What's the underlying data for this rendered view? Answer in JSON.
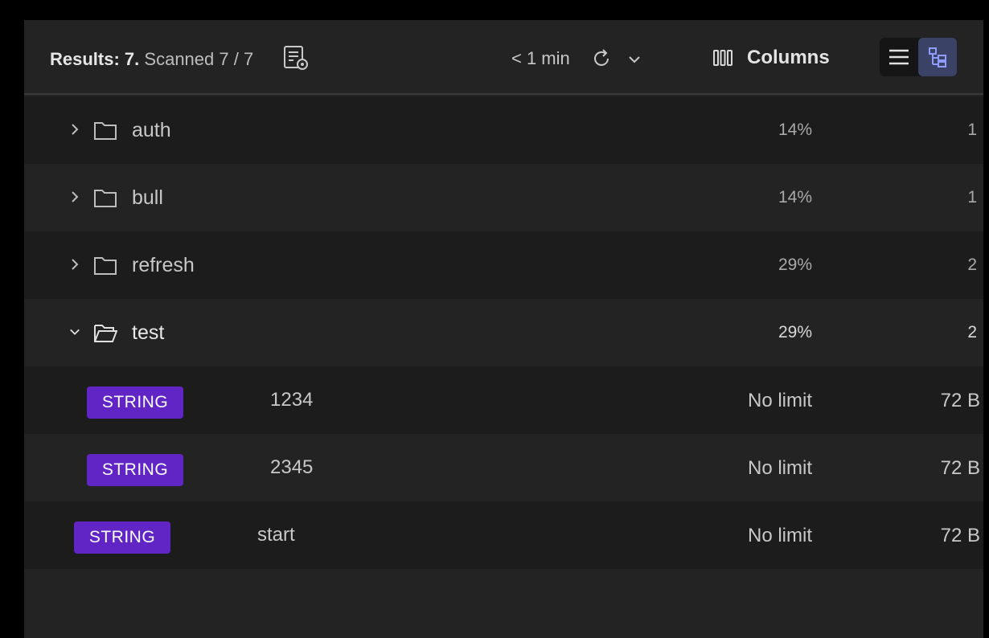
{
  "toolbar": {
    "results_label": "Results:",
    "results_count": "7.",
    "scanned_text": "Scanned 7 / 7",
    "scan_settings_icon": "scan-settings-icon",
    "last_refresh": "< 1 min",
    "refresh_icon": "refresh-icon",
    "auto_refresh_icon": "chevron-down-icon",
    "columns_icon": "columns-icon",
    "columns_label": "Columns",
    "view_list_icon": "list-view-icon",
    "view_tree_icon": "tree-view-icon",
    "active_view": "tree"
  },
  "rows": [
    {
      "kind": "folder",
      "name": "auth",
      "percent": "14%",
      "count": "1",
      "expanded": false
    },
    {
      "kind": "folder",
      "name": "bull",
      "percent": "14%",
      "count": "1",
      "expanded": false
    },
    {
      "kind": "folder",
      "name": "refresh",
      "percent": "29%",
      "count": "2",
      "expanded": false
    },
    {
      "kind": "folder",
      "name": "test",
      "percent": "29%",
      "count": "2",
      "expanded": true
    },
    {
      "kind": "key",
      "type": "STRING",
      "name": "1234",
      "ttl": "No limit",
      "size": "72 B",
      "depth": 1
    },
    {
      "kind": "key",
      "type": "STRING",
      "name": "2345",
      "ttl": "No limit",
      "size": "72 B",
      "depth": 1
    },
    {
      "kind": "key",
      "type": "STRING",
      "name": "start",
      "ttl": "No limit",
      "size": "72 B",
      "depth": 0
    }
  ],
  "colors": {
    "string_badge": "#6025c4",
    "active_view_bg": "#3a4266",
    "active_view_icon": "#8f9bff"
  }
}
